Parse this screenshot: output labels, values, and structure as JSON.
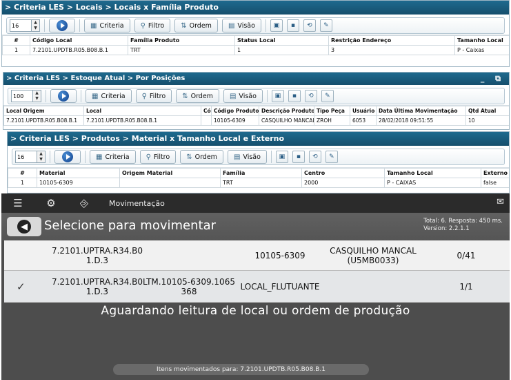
{
  "panel1": {
    "breadcrumb": "> Criteria LES > Locais > Locais x Família Produto",
    "page_size": "16",
    "buttons": {
      "criteria": "Criteria",
      "filtro": "Filtro",
      "ordem": "Ordem",
      "visao": "Visão"
    },
    "columns": [
      "#",
      "Código Local",
      "Família Produto",
      "Status Local",
      "Restrição Endereço",
      "Tamanho Local"
    ],
    "rows": [
      [
        "1",
        "7.2101.UPDTB.R05.B08.B.1",
        "TRT",
        "1",
        "3",
        "P - Caixas"
      ]
    ]
  },
  "panel2": {
    "breadcrumb": "> Criteria LES > Estoque Atual > Por Posições",
    "page_size": "100",
    "window_controls": "_ ⧉",
    "buttons": {
      "criteria": "Criteria",
      "filtro": "Filtro",
      "ordem": "Ordem",
      "visao": "Visão"
    },
    "columns": [
      "Local Origem",
      "Local",
      "Có",
      "Código Produto",
      "Descrição Produto",
      "Tipo Peça",
      "Usuário",
      "Data Última Movimentação",
      "Qtd Atual"
    ],
    "rows": [
      [
        "7.2101.UPDTB.R05.B08.B.1",
        "7.2101.UPDTB.R05.B08.B.1",
        "",
        "10105-6309",
        "CASQUILHO MANCAL",
        "ZROH",
        "6053",
        "28/02/2018 09:51:55",
        "10"
      ]
    ]
  },
  "panel3": {
    "breadcrumb": "> Criteria LES > Produtos > Material x Tamanho Local e Externo",
    "page_size": "16",
    "buttons": {
      "criteria": "Criteria",
      "filtro": "Filtro",
      "ordem": "Ordem",
      "visao": "Visão"
    },
    "columns": [
      "#",
      "Material",
      "Origem Material",
      "Família",
      "Centro",
      "Tamanho Local",
      "Externo"
    ],
    "rows": [
      [
        "1",
        "10105-6309",
        "",
        "TRT",
        "2000",
        "P - CAIXAS",
        "false"
      ]
    ]
  },
  "app": {
    "title": "Movimentação",
    "subtitle": "Selecione para movimentar",
    "total_line": "Total: 6. Resposta: 450 ms.",
    "version_line": "Version: 2.2.1.1",
    "items": [
      {
        "local_line1": "7.2101.UPTRA.R34.B0",
        "local_line2": "1.D.3",
        "ltm_line1": "",
        "ltm_line2": "",
        "product": "10105-6309",
        "desc_line1": "CASQUILHO MANCAL",
        "desc_line2": "(U5MB0033)",
        "qty": "0/41"
      },
      {
        "local_line1": "7.2101.UPTRA.R34.B0",
        "local_line2": "1.D.3",
        "ltm_line1": "LTM.10105-6309.1065",
        "ltm_line2": "368",
        "product": "LOCAL_FLUTUANTE",
        "desc_line1": "",
        "desc_line2": "",
        "qty": "1/1"
      }
    ],
    "status_message": "Aguardando leitura de local ou ordem de produção",
    "footer_pill": "Itens movimentados para: 7.2101.UPDTB.R05.B08.B.1"
  },
  "colors": {
    "panel_header": "#1e6a8e",
    "app_bar": "#2b2b2b",
    "app_background": "#4d4d4d"
  }
}
